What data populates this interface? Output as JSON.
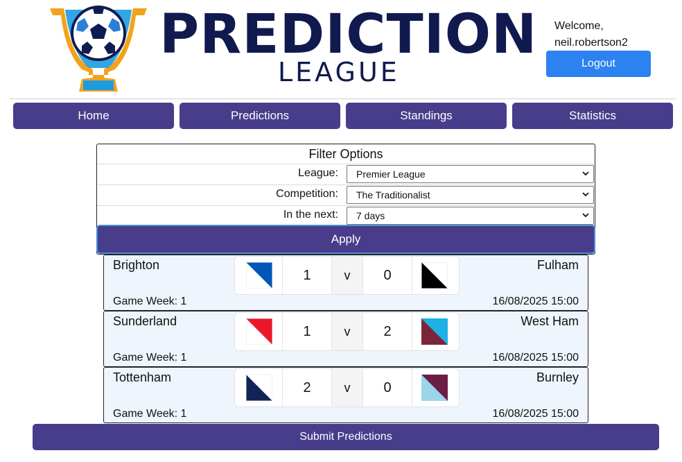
{
  "header": {
    "logo_title": "PREDICTION",
    "logo_subtitle": "LEAGUE",
    "welcome_label": "Welcome,",
    "username": "neil.robertson2",
    "logout_label": "Logout"
  },
  "nav": {
    "items": [
      {
        "label": "Home"
      },
      {
        "label": "Predictions"
      },
      {
        "label": "Standings"
      },
      {
        "label": "Statistics"
      }
    ]
  },
  "filter": {
    "title": "Filter Options",
    "league_label": "League:",
    "league_value": "Premier League",
    "competition_label": "Competition:",
    "competition_value": "The Traditionalist",
    "next_label": "In the next:",
    "next_value": "7 days",
    "apply_label": "Apply"
  },
  "matches": [
    {
      "home": "Brighton",
      "away": "Fulham",
      "home_score": "1",
      "away_score": "0",
      "vs": "v",
      "game_week": "Game Week: 1",
      "datetime": "16/08/2025 15:00",
      "home_colors": [
        "#ffffff",
        "#0057b8"
      ],
      "away_colors": [
        "#ffffff",
        "#000000"
      ]
    },
    {
      "home": "Sunderland",
      "away": "West Ham",
      "home_score": "1",
      "away_score": "2",
      "vs": "v",
      "game_week": "Game Week: 1",
      "datetime": "16/08/2025 15:00",
      "home_colors": [
        "#ffffff",
        "#eb172b"
      ],
      "away_colors": [
        "#1bb1e7",
        "#7a263a"
      ]
    },
    {
      "home": "Tottenham",
      "away": "Burnley",
      "home_score": "2",
      "away_score": "0",
      "vs": "v",
      "game_week": "Game Week: 1",
      "datetime": "16/08/2025 15:00",
      "home_colors": [
        "#ffffff",
        "#132257"
      ],
      "away_colors": [
        "#99d6ea",
        "#6c1d45"
      ]
    }
  ],
  "submit_label": "Submit Predictions",
  "colors": {
    "primary": "#473d8b",
    "logout": "#2b82f0",
    "navy": "#101a4f",
    "card_bg": "#eef5fc"
  },
  "icons": {
    "logo": "trophy-football-icon",
    "select_arrow": "chevron-down-icon",
    "team_badge": "team-flag-icon"
  }
}
